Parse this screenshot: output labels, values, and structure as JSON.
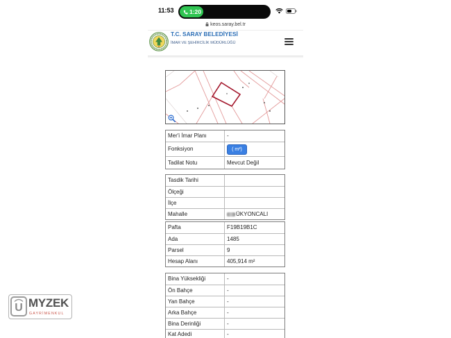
{
  "colors": {
    "title_blue": "#2a6db5",
    "button_blue": "#3a80e3",
    "call_green": "#30c552",
    "parcel_red": "#a3162b",
    "map_line": "#e39a9a",
    "watermark_red": "#c0392b"
  },
  "status_bar": {
    "time": "11:53",
    "call_timer": "1:20",
    "icons": [
      "phone-icon",
      "wifi-icon",
      "battery-icon"
    ]
  },
  "browser": {
    "url": "keos.saray.bel.tr",
    "lock_icon": "lock-icon"
  },
  "header": {
    "logo": "municipality-seal-logo",
    "title": "T.C. SARAY BELEDİYESİ",
    "subtitle": "İMAR VE ŞEHİRCİLİK MÜDÜRLÜĞÜ",
    "menu_icon": "hamburger-menu-icon"
  },
  "map": {
    "zoom_icon": "zoom-in-icon"
  },
  "plan_table": [
    {
      "label": "Mer'i İmar Planı",
      "value": "-"
    },
    {
      "label": "Fonksiyon",
      "button": "( m²)"
    },
    {
      "label": "Tadilat Notu",
      "value": "Mevcut Değil"
    }
  ],
  "approval_table": [
    {
      "label": "Tasdik Tarihi"
    },
    {
      "label": "Ölçeği"
    },
    {
      "label": "İlçe"
    },
    {
      "label": "Mahalle",
      "value": "ÜKYONCALI"
    }
  ],
  "parcel_table": [
    {
      "label": "Pafta",
      "value": "F19B19B1C"
    },
    {
      "label": "Ada",
      "value": "1485"
    },
    {
      "label": "Parsel",
      "value": "9"
    },
    {
      "label": "Hesap Alanı",
      "value": "405,914 m²"
    }
  ],
  "building_table": [
    {
      "label": "Bina Yüksekliği",
      "value": "-"
    },
    {
      "label": "Ön Bahçe",
      "value": "-"
    },
    {
      "label": "Yan Bahçe",
      "value": "-"
    },
    {
      "label": "Arka Bahçe",
      "value": "-"
    },
    {
      "label": "Bina Derinliği",
      "value": "-"
    },
    {
      "label": "Kat Adedi",
      "value": "-"
    }
  ],
  "watermark": {
    "initial": "U",
    "brand": "MYZEK",
    "tagline": "GAYRİMENKUL"
  }
}
